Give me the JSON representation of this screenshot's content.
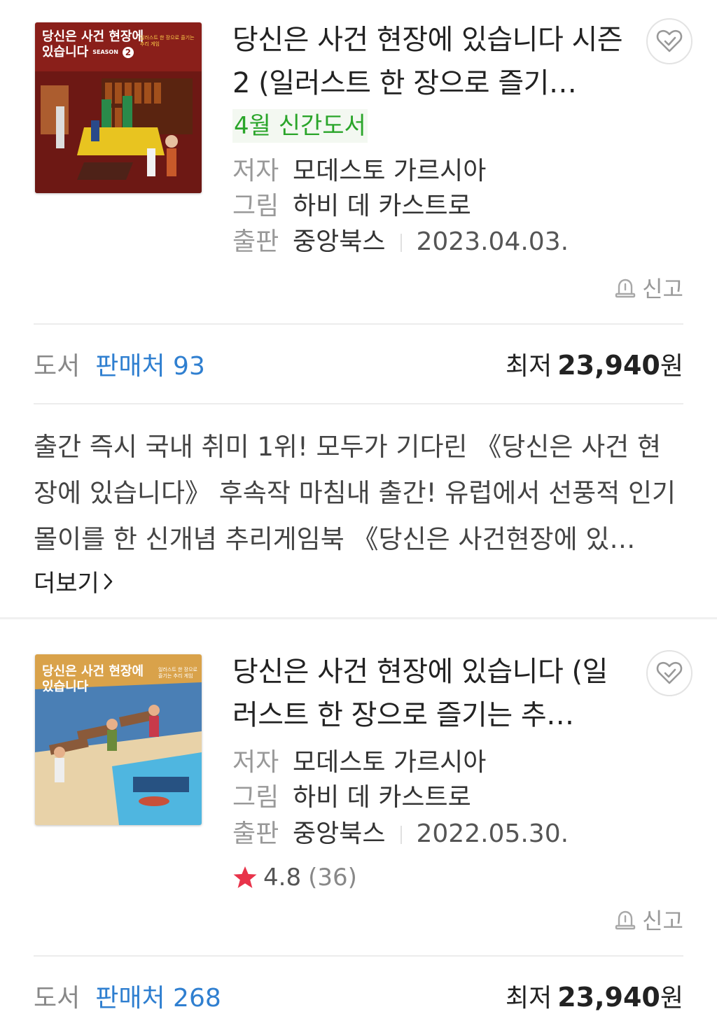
{
  "items": [
    {
      "title": "당신은 사건 현장에 있습니다 시즌 2 (일러스트 한 장으로 즐기…",
      "badge": "4월 신간도서",
      "author_label": "저자",
      "author": "모데스토 가르시아",
      "illustrator_label": "그림",
      "illustrator": "하비 데 카스트로",
      "publisher_label": "출판",
      "publisher": "중앙북스",
      "date": "2023.04.03.",
      "report_label": "신고",
      "category": "도서",
      "sellers": "판매처 93",
      "price_prefix": "최저",
      "price": "23,940",
      "price_unit": "원",
      "cover": {
        "title_line1": "당신은 사건 현장에",
        "title_line2": "있습니다",
        "season": "SEASON",
        "season_num": "2",
        "subtitle": "일러스트 한 장으로 즐기는 추리 게임",
        "bg": "#8a1f1a"
      },
      "description": "출간 즉시 국내 취미 1위! 모두가 기다린 《당신은 사건 현장에 있습니다》 후속작 마침내 출간! 유럽에서 선풍적 인기몰이를 한 신개념 추리게임북 《당신은 사건현장에 있…",
      "more_label": "더보기"
    },
    {
      "title": "당신은 사건 현장에 있습니다 (일러스트 한 장으로 즐기는 추…",
      "author_label": "저자",
      "author": "모데스토 가르시아",
      "illustrator_label": "그림",
      "illustrator": "하비 데 카스트로",
      "publisher_label": "출판",
      "publisher": "중앙북스",
      "date": "2022.05.30.",
      "rating": "4.8",
      "rating_count": "(36)",
      "report_label": "신고",
      "category": "도서",
      "sellers": "판매처 268",
      "price_prefix": "최저",
      "price": "23,940",
      "price_unit": "원",
      "cover": {
        "title_line1": "당신은 사건 현장에",
        "title_line2": "있습니다",
        "subtitle": "일러스트 한 장으로 즐기는 추리 게임",
        "bg": "#d9a24a"
      }
    }
  ],
  "colors": {
    "accent_blue": "#2f7fd0",
    "badge_green": "#2aa52a",
    "star_red": "#e8334a"
  },
  "icons": {
    "favorite": "heart-check-icon",
    "report": "siren-icon",
    "rating": "star-icon",
    "more": "chevron-right-icon"
  }
}
